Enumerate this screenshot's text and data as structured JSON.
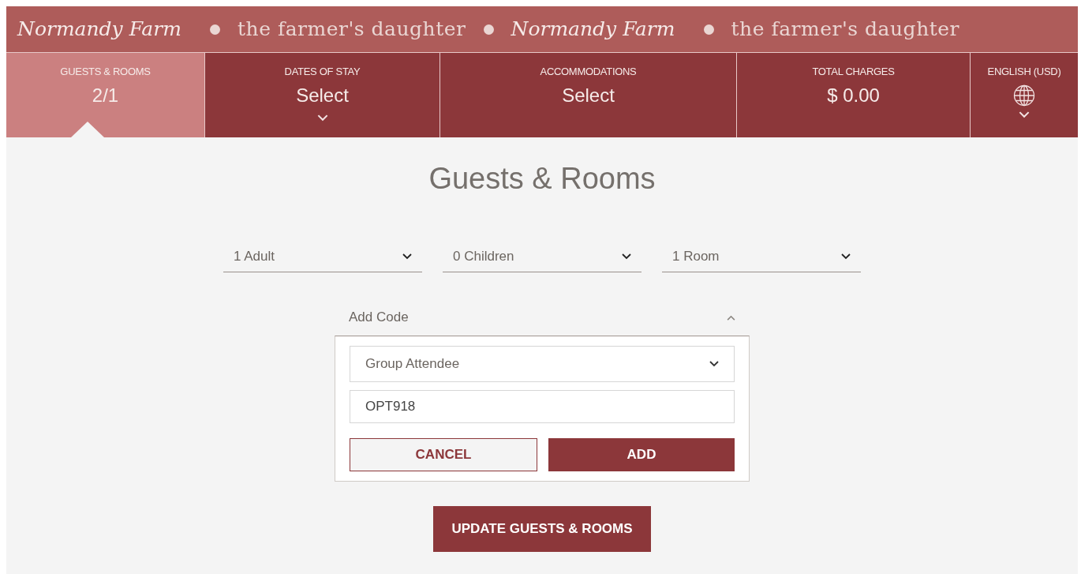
{
  "banner": [
    {
      "kind": "script",
      "text": "Normandy Farm"
    },
    {
      "kind": "plain",
      "text": "the farmer's daughter"
    },
    {
      "kind": "script",
      "text": "Normandy Farm"
    },
    {
      "kind": "plain",
      "text": "the farmer's daughter"
    }
  ],
  "tabs": [
    {
      "kind": "value",
      "label": "GUESTS & ROOMS",
      "value": "2/1",
      "selected": true
    },
    {
      "kind": "dropdown",
      "label": "DATES OF STAY",
      "value": "Select",
      "selected": false
    },
    {
      "kind": "value",
      "label": "ACCOMMODATIONS",
      "value": "Select",
      "selected": false
    },
    {
      "kind": "value",
      "label": "TOTAL CHARGES",
      "value": "$ 0.00",
      "selected": false
    },
    {
      "kind": "language",
      "label": "ENGLISH (USD)",
      "selected": false
    }
  ],
  "heading": "Guests & Rooms",
  "selects": [
    {
      "value": "1 Adult"
    },
    {
      "value": "0 Children"
    },
    {
      "value": "1 Room"
    }
  ],
  "code_section": {
    "title": "Add Code",
    "expanded": true,
    "code_type": "Group Attendee",
    "code": "OPT918",
    "cancel": "CANCEL",
    "add": "ADD"
  },
  "submit": "UPDATE GUESTS & ROOMS"
}
